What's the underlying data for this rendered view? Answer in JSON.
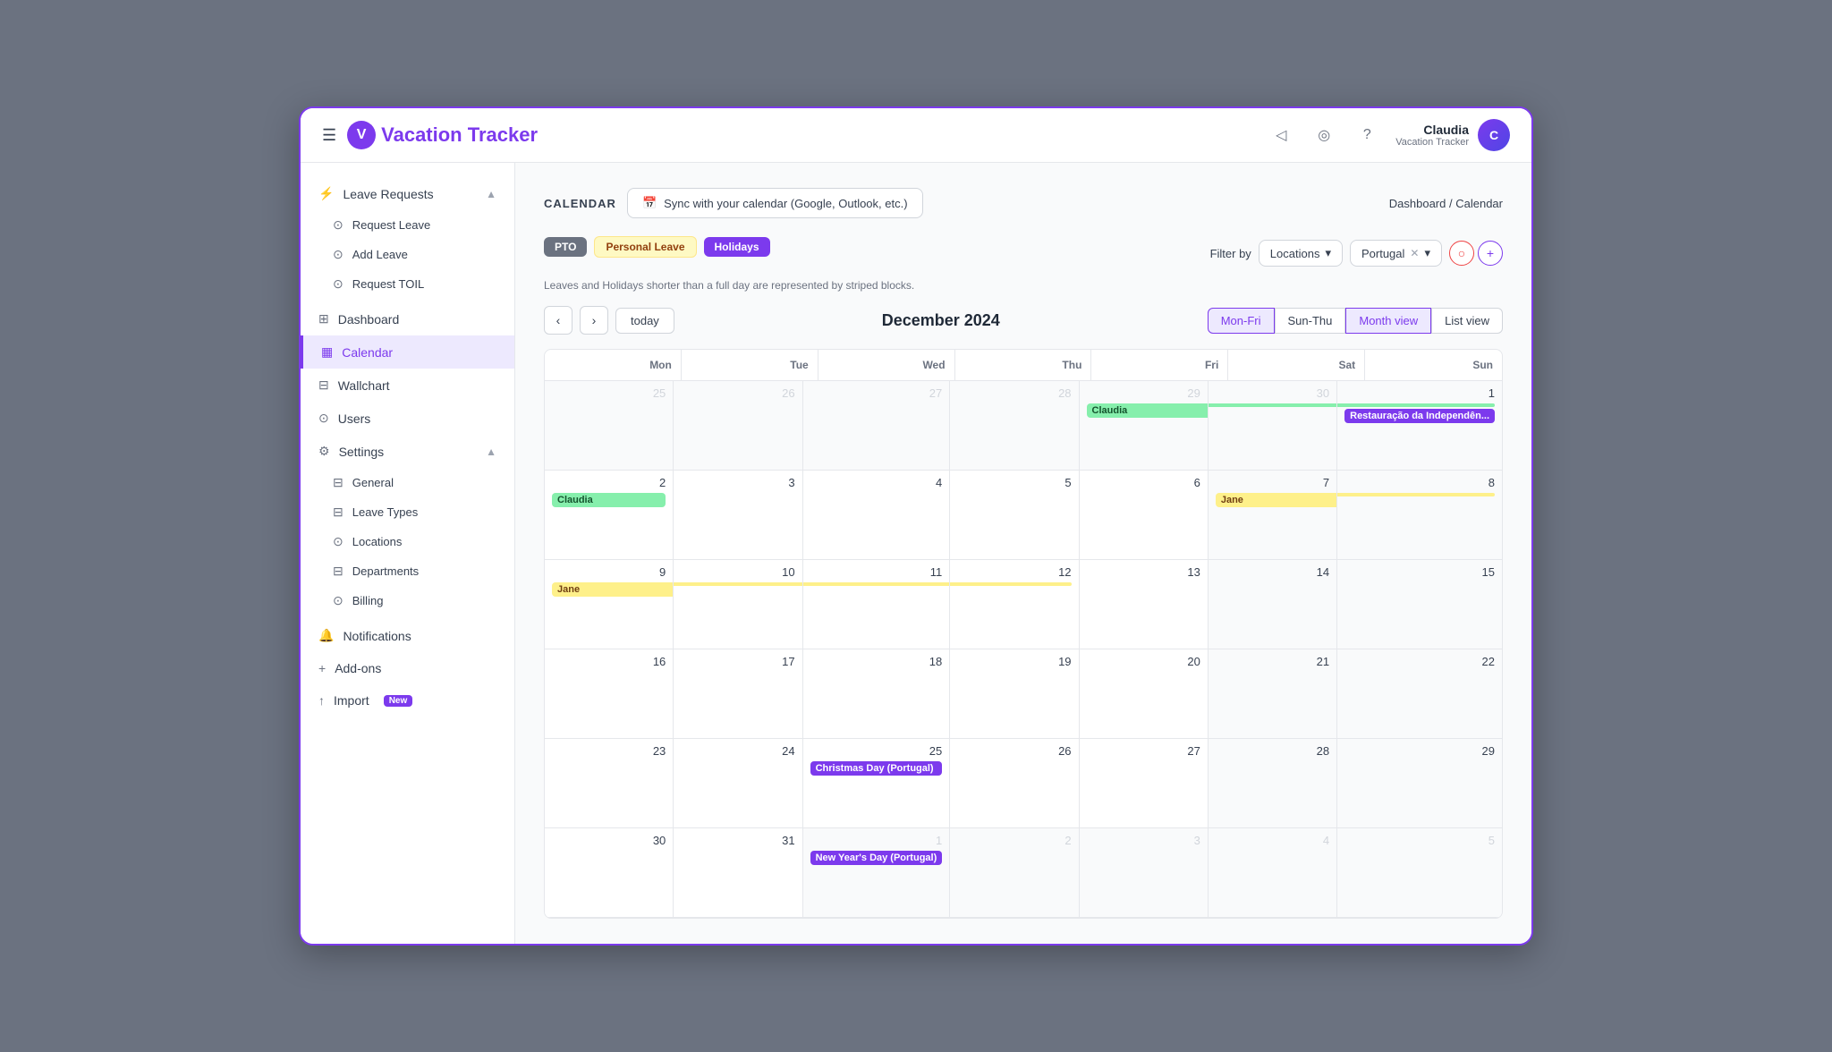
{
  "app": {
    "title": "Vacation Tracker",
    "logo_letter": "V"
  },
  "header": {
    "hamburger_label": "☰",
    "icons": {
      "notification": "◁",
      "location": "◎",
      "help": "?"
    },
    "user": {
      "name": "Claudia",
      "subtitle": "Vacation Tracker"
    }
  },
  "sidebar": {
    "leave_requests_label": "Leave Requests",
    "sub_items": [
      {
        "label": "Request Leave",
        "icon": "⊙"
      },
      {
        "label": "Add Leave",
        "icon": "⊙"
      },
      {
        "label": "Request TOIL",
        "icon": "⊙"
      }
    ],
    "main_items": [
      {
        "label": "Dashboard",
        "icon": "⊞",
        "active": false
      },
      {
        "label": "Calendar",
        "icon": "▦",
        "active": true
      },
      {
        "label": "Wallchart",
        "icon": "⊟",
        "active": false
      },
      {
        "label": "Users",
        "icon": "⊙",
        "active": false
      }
    ],
    "settings_label": "Settings",
    "settings_items": [
      {
        "label": "General",
        "icon": "⊟"
      },
      {
        "label": "Leave Types",
        "icon": "⊟"
      },
      {
        "label": "Locations",
        "icon": "⊙"
      },
      {
        "label": "Departments",
        "icon": "⊟"
      },
      {
        "label": "Billing",
        "icon": "⊙"
      }
    ],
    "bottom_items": [
      {
        "label": "Notifications",
        "icon": "⊙"
      },
      {
        "label": "Add-ons",
        "icon": "+"
      },
      {
        "label": "Import",
        "icon": "⊙",
        "badge": "New"
      }
    ]
  },
  "calendar": {
    "section_label": "CALENDAR",
    "sync_button": "Sync with your calendar (Google, Outlook, etc.)",
    "breadcrumb_home": "Dashboard",
    "breadcrumb_separator": "/",
    "breadcrumb_current": "Calendar",
    "legend": [
      {
        "label": "PTO",
        "type": "pto"
      },
      {
        "label": "Personal Leave",
        "type": "personal"
      },
      {
        "label": "Holidays",
        "type": "holidays"
      }
    ],
    "filter_note": "Leaves and Holidays shorter than a full day are represented by striped blocks.",
    "filter_by_label": "Filter by",
    "filter_type": "Locations",
    "filter_value": "Portugal",
    "month_title": "December 2024",
    "today_label": "today",
    "view_buttons": [
      {
        "label": "Mon-Fri",
        "active": true
      },
      {
        "label": "Sun-Thu",
        "active": false
      },
      {
        "label": "Month view",
        "active": true
      },
      {
        "label": "List view",
        "active": false
      }
    ],
    "day_headers": [
      "Mon",
      "Tue",
      "Wed",
      "Thu",
      "Fri",
      "Sat",
      "Sun"
    ],
    "weeks": [
      {
        "days": [
          {
            "date": "25",
            "other_month": true,
            "weekend": false,
            "events": []
          },
          {
            "date": "26",
            "other_month": true,
            "weekend": false,
            "events": []
          },
          {
            "date": "27",
            "other_month": true,
            "weekend": false,
            "events": []
          },
          {
            "date": "28",
            "other_month": true,
            "weekend": false,
            "events": []
          },
          {
            "date": "29",
            "other_month": true,
            "weekend": false,
            "events": [
              {
                "label": "Claudia",
                "type": "green",
                "span": "start"
              }
            ]
          },
          {
            "date": "30",
            "other_month": true,
            "weekend": true,
            "events": [
              {
                "label": "",
                "type": "green",
                "span": "middle"
              }
            ]
          },
          {
            "date": "1",
            "other_month": false,
            "weekend": true,
            "events": [
              {
                "label": "",
                "type": "green",
                "span": "end"
              },
              {
                "label": "Restauração da Independên...",
                "type": "purple_holiday"
              }
            ]
          }
        ]
      },
      {
        "days": [
          {
            "date": "2",
            "other_month": false,
            "weekend": false,
            "events": [
              {
                "label": "Claudia",
                "type": "green",
                "span": "single"
              }
            ]
          },
          {
            "date": "3",
            "other_month": false,
            "weekend": false,
            "events": []
          },
          {
            "date": "4",
            "other_month": false,
            "weekend": false,
            "events": []
          },
          {
            "date": "5",
            "other_month": false,
            "weekend": false,
            "events": []
          },
          {
            "date": "6",
            "other_month": false,
            "weekend": false,
            "events": []
          },
          {
            "date": "7",
            "other_month": false,
            "weekend": true,
            "events": [
              {
                "label": "Jane",
                "type": "yellow",
                "span": "start"
              }
            ]
          },
          {
            "date": "8",
            "other_month": false,
            "weekend": true,
            "events": [
              {
                "label": "",
                "type": "yellow",
                "span": "end"
              }
            ]
          }
        ]
      },
      {
        "days": [
          {
            "date": "9",
            "other_month": false,
            "weekend": false,
            "events": [
              {
                "label": "Jane",
                "type": "yellow",
                "span": "start"
              }
            ]
          },
          {
            "date": "10",
            "other_month": false,
            "weekend": false,
            "events": [
              {
                "label": "",
                "type": "yellow",
                "span": "middle"
              }
            ]
          },
          {
            "date": "11",
            "other_month": false,
            "weekend": false,
            "events": [
              {
                "label": "",
                "type": "yellow",
                "span": "middle"
              }
            ]
          },
          {
            "date": "12",
            "other_month": false,
            "weekend": false,
            "events": [
              {
                "label": "",
                "type": "yellow",
                "span": "end"
              }
            ]
          },
          {
            "date": "13",
            "other_month": false,
            "weekend": false,
            "events": []
          },
          {
            "date": "14",
            "other_month": false,
            "weekend": true,
            "events": []
          },
          {
            "date": "15",
            "other_month": false,
            "weekend": true,
            "events": []
          }
        ]
      },
      {
        "days": [
          {
            "date": "16",
            "other_month": false,
            "weekend": false,
            "events": []
          },
          {
            "date": "17",
            "other_month": false,
            "weekend": false,
            "events": []
          },
          {
            "date": "18",
            "other_month": false,
            "weekend": false,
            "events": []
          },
          {
            "date": "19",
            "other_month": false,
            "weekend": false,
            "events": []
          },
          {
            "date": "20",
            "other_month": false,
            "weekend": false,
            "events": []
          },
          {
            "date": "21",
            "other_month": false,
            "weekend": true,
            "events": []
          },
          {
            "date": "22",
            "other_month": false,
            "weekend": true,
            "events": []
          }
        ]
      },
      {
        "days": [
          {
            "date": "23",
            "other_month": false,
            "weekend": false,
            "events": []
          },
          {
            "date": "24",
            "other_month": false,
            "weekend": false,
            "events": []
          },
          {
            "date": "25",
            "other_month": false,
            "weekend": false,
            "events": [
              {
                "label": "Christmas Day (Portugal)",
                "type": "purple_holiday"
              }
            ]
          },
          {
            "date": "26",
            "other_month": false,
            "weekend": false,
            "events": []
          },
          {
            "date": "27",
            "other_month": false,
            "weekend": false,
            "events": []
          },
          {
            "date": "28",
            "other_month": false,
            "weekend": true,
            "events": []
          },
          {
            "date": "29",
            "other_month": false,
            "weekend": true,
            "events": []
          }
        ]
      },
      {
        "days": [
          {
            "date": "30",
            "other_month": false,
            "weekend": false,
            "events": []
          },
          {
            "date": "31",
            "other_month": false,
            "weekend": false,
            "events": []
          },
          {
            "date": "1",
            "other_month": true,
            "weekend": false,
            "events": [
              {
                "label": "New Year's Day (Portugal)",
                "type": "purple_holiday"
              }
            ]
          },
          {
            "date": "2",
            "other_month": true,
            "weekend": false,
            "events": []
          },
          {
            "date": "3",
            "other_month": true,
            "weekend": false,
            "events": []
          },
          {
            "date": "4",
            "other_month": true,
            "weekend": true,
            "events": []
          },
          {
            "date": "5",
            "other_month": true,
            "weekend": true,
            "events": []
          }
        ]
      }
    ]
  }
}
